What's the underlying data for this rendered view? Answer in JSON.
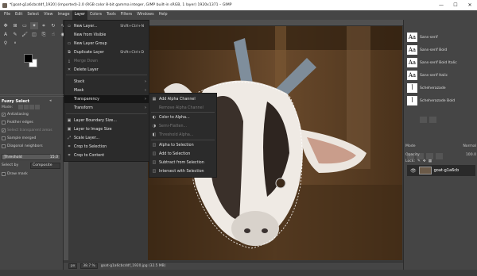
{
  "window": {
    "title": "*[goat-g1a6cbcddf_1920] (imported)-2.0 (RGB color 8-bit gamma integer, GIMP built-in sRGB, 1 layer) 1920x1371 – GIMP",
    "min": "—",
    "max": "☐",
    "close": "✕"
  },
  "menubar": [
    "File",
    "Edit",
    "Select",
    "View",
    "Image",
    "Layer",
    "Colors",
    "Tools",
    "Filters",
    "Windows",
    "Help"
  ],
  "tool_options": {
    "title": "Fuzzy Select",
    "mode_label": "Mode:",
    "antialiasing": "Antialiasing",
    "feather_edges": "Feather edges",
    "select_transparent": "Select transparent areas",
    "sample_merged": "Sample merged",
    "diagonal_neighbors": "Diagonal neighbors",
    "threshold_label": "Threshold",
    "threshold_value": "15.0",
    "threshold_fraction": 0.06,
    "select_by_label": "Select by",
    "select_by_value": "Composite",
    "draw_mask": "Draw mask"
  },
  "layer_menu": {
    "items": [
      {
        "label": "New Layer...",
        "shortcut": "Shift+Ctrl+N",
        "icon": "new-layer-icon",
        "glyph": "▫"
      },
      {
        "label": "New from Visible",
        "shortcut": "",
        "icon": "",
        "glyph": ""
      },
      {
        "label": "New Layer Group",
        "shortcut": "",
        "icon": "layer-group-icon",
        "glyph": "▭"
      },
      {
        "label": "Duplicate Layer",
        "shortcut": "Shift+Ctrl+D",
        "icon": "duplicate-icon",
        "glyph": "⧉"
      },
      {
        "label": "Merge Down",
        "shortcut": "",
        "icon": "merge-icon",
        "glyph": "⤓",
        "disabled": true
      },
      {
        "label": "Delete Layer",
        "shortcut": "",
        "icon": "delete-icon",
        "glyph": "✕"
      },
      {
        "label": "Stack",
        "arrow": "›"
      },
      {
        "label": "Mask",
        "arrow": "›"
      },
      {
        "label": "Transparency",
        "arrow": "›",
        "highlighted": true
      },
      {
        "label": "Transform",
        "arrow": "›"
      },
      {
        "label": "Layer Boundary Size...",
        "icon": "boundary-icon",
        "glyph": "▣"
      },
      {
        "label": "Layer to Image Size",
        "icon": "to-image-icon",
        "glyph": "▣"
      },
      {
        "label": "Scale Layer...",
        "icon": "scale-icon",
        "glyph": "⤢"
      },
      {
        "label": "Crop to Selection",
        "icon": "crop-icon",
        "glyph": "⌗"
      },
      {
        "label": "Crop to Content",
        "icon": "crop-content-icon",
        "glyph": "⌗"
      }
    ]
  },
  "transparency_menu": {
    "items": [
      {
        "label": "Add Alpha Channel",
        "icon": "add-alpha-icon",
        "glyph": "▦"
      },
      {
        "label": "Remove Alpha Channel",
        "disabled": true
      },
      {
        "label": "Color to Alpha...",
        "icon": "color-alpha-icon",
        "glyph": "◐"
      },
      {
        "label": "Semi-Flatten...",
        "disabled": true,
        "icon": "flatten-icon",
        "glyph": "◑"
      },
      {
        "label": "Threshold Alpha...",
        "disabled": true,
        "icon": "threshold-icon",
        "glyph": "◧"
      },
      {
        "label": "Alpha to Selection",
        "icon": "alpha-sel-icon",
        "glyph": "◫"
      },
      {
        "label": "Add to Selection",
        "icon": "add-sel-icon",
        "glyph": "◫"
      },
      {
        "label": "Subtract from Selection",
        "icon": "sub-sel-icon",
        "glyph": "◫"
      },
      {
        "label": "Intersect with Selection",
        "icon": "int-sel-icon",
        "glyph": "◫"
      }
    ]
  },
  "fonts": [
    {
      "preview": "Aa",
      "name": "Sans-serif"
    },
    {
      "preview": "Aa",
      "name": "Sans-serif Bold"
    },
    {
      "preview": "Aa",
      "name": "Sans-serif Bold Italic"
    },
    {
      "preview": "Aa",
      "name": "Sans-serif Italic"
    },
    {
      "preview": "ﺃ",
      "name": "Scheherazade"
    },
    {
      "preview": "ﺃ",
      "name": "Scheherazade Bold"
    }
  ],
  "layers": {
    "mode_label": "Mode",
    "mode_value": "Normal",
    "opacity_label": "Opacity",
    "opacity_value": "100.0",
    "lock_label": "Lock:",
    "layer_name": "goat-g1a6cb",
    "eye": "👁"
  },
  "status": {
    "unit": "px",
    "zoom": "38.7 %",
    "file": "goat-g1a6cbcddf_1920.jpg (32.5 MB)"
  },
  "colors": {
    "menu_bg": "#2b2b2b",
    "panel_bg": "#454545",
    "highlight": "#161616"
  }
}
